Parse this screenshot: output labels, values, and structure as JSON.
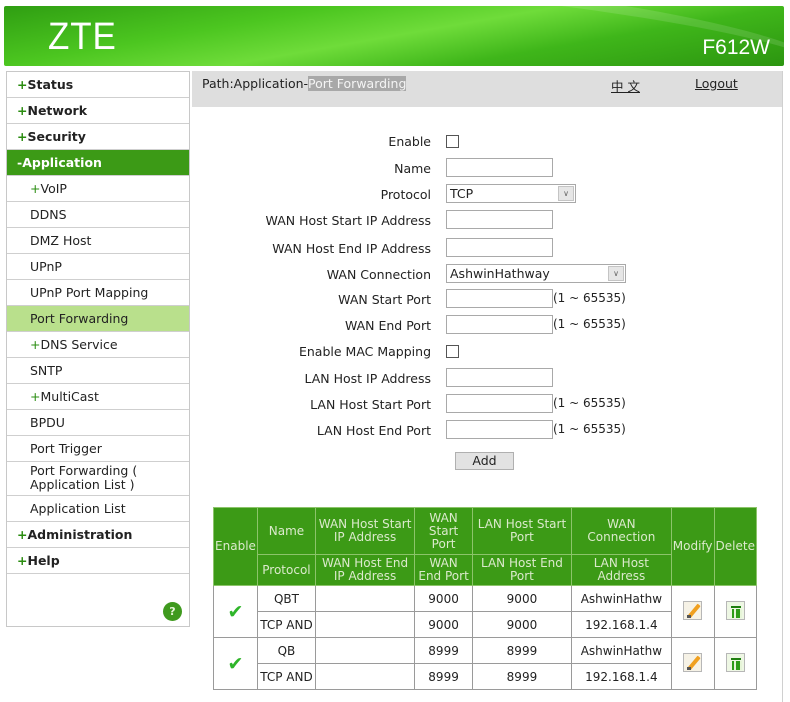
{
  "header": {
    "logo": "ZTE",
    "model": "F612W",
    "colors": {
      "brand_green": "#3c9a16",
      "active_nav": "#b9e08c"
    }
  },
  "sidebar": {
    "items": [
      {
        "prefix": "+",
        "label": "Status",
        "level": "top"
      },
      {
        "prefix": "+",
        "label": "Network",
        "level": "top"
      },
      {
        "prefix": "+",
        "label": "Security",
        "level": "top"
      },
      {
        "prefix": "-",
        "label": "Application",
        "level": "top",
        "state": "expanded"
      },
      {
        "prefix": "+",
        "label": "VoIP",
        "level": "sub"
      },
      {
        "prefix": "",
        "label": "DDNS",
        "level": "sub"
      },
      {
        "prefix": "",
        "label": "DMZ Host",
        "level": "sub"
      },
      {
        "prefix": "",
        "label": "UPnP",
        "level": "sub"
      },
      {
        "prefix": "",
        "label": "UPnP Port Mapping",
        "level": "sub"
      },
      {
        "prefix": "",
        "label": "Port Forwarding",
        "level": "sub",
        "state": "active"
      },
      {
        "prefix": "+",
        "label": "DNS Service",
        "level": "sub"
      },
      {
        "prefix": "",
        "label": "SNTP",
        "level": "sub"
      },
      {
        "prefix": "+",
        "label": "MultiCast",
        "level": "sub"
      },
      {
        "prefix": "",
        "label": "BPDU",
        "level": "sub"
      },
      {
        "prefix": "",
        "label": "Port Trigger",
        "level": "sub"
      },
      {
        "prefix": "",
        "label": "Port Forwarding ( Application List )",
        "level": "sub"
      },
      {
        "prefix": "",
        "label": "Application List",
        "level": "sub"
      },
      {
        "prefix": "+",
        "label": "Administration",
        "level": "top"
      },
      {
        "prefix": "+",
        "label": "Help",
        "level": "top"
      }
    ],
    "help_icon": "?"
  },
  "pathbar": {
    "prefix": "Path:Application-",
    "current": "Port Forwarding",
    "language_link": "中 文",
    "logout": "Logout"
  },
  "form": {
    "enable_label": "Enable",
    "enable_checked": false,
    "name_label": "Name",
    "name_value": "",
    "protocol_label": "Protocol",
    "protocol_value": "TCP",
    "wan_host_start_ip_label": "WAN Host Start IP Address",
    "wan_host_start_ip_value": "",
    "wan_host_end_ip_label": "WAN Host End IP Address",
    "wan_host_end_ip_value": "",
    "wan_connection_label": "WAN Connection",
    "wan_connection_value": "AshwinHathway",
    "wan_start_port_label": "WAN Start Port",
    "wan_start_port_value": "",
    "wan_end_port_label": "WAN End Port",
    "wan_end_port_value": "",
    "enable_mac_label": "Enable MAC Mapping",
    "enable_mac_checked": false,
    "lan_host_ip_label": "LAN Host IP Address",
    "lan_host_ip_value": "",
    "lan_host_start_port_label": "LAN Host Start Port",
    "lan_host_start_port_value": "",
    "lan_host_end_port_label": "LAN Host End Port",
    "lan_host_end_port_value": "",
    "port_range_hint": "(1 ~ 65535)",
    "add_button": "Add"
  },
  "table": {
    "headers": {
      "enable": "Enable",
      "name": "Name",
      "protocol": "Protocol",
      "wan_host_start_ip": "WAN Host Start IP Address",
      "wan_host_end_ip": "WAN Host End IP Address",
      "wan_start_port": "WAN Start Port",
      "wan_end_port": "WAN End Port",
      "lan_host_start_port": "LAN Host Start Port",
      "lan_host_end_port": "LAN Host End Port",
      "wan_connection": "WAN Connection",
      "lan_host_address": "LAN Host Address",
      "modify": "Modify",
      "delete": "Delete"
    },
    "rows": [
      {
        "enabled": true,
        "name": "QBT",
        "protocol": "TCP AND",
        "wan_host_start_ip": "",
        "wan_host_end_ip": "",
        "wan_start_port": "9000",
        "wan_end_port": "9000",
        "lan_host_start_port": "9000",
        "lan_host_end_port": "9000",
        "wan_connection": "AshwinHathw",
        "lan_host_address": "192.168.1.4"
      },
      {
        "enabled": true,
        "name": "QB",
        "protocol": "TCP AND",
        "wan_host_start_ip": "",
        "wan_host_end_ip": "",
        "wan_start_port": "8999",
        "wan_end_port": "8999",
        "lan_host_start_port": "8999",
        "lan_host_end_port": "8999",
        "wan_connection": "AshwinHathw",
        "lan_host_address": "192.168.1.4"
      }
    ]
  }
}
